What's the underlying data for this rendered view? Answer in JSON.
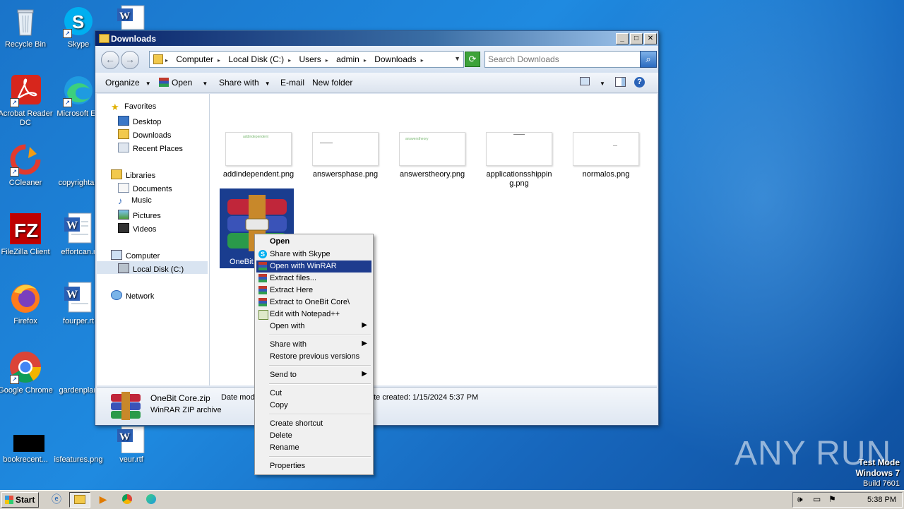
{
  "desktop": {
    "icons": [
      {
        "label": "Recycle Bin"
      },
      {
        "label": "Skype"
      },
      {
        "label": "Acrobat Reader DC"
      },
      {
        "label": "Microsoft Ed"
      },
      {
        "label": "CCleaner"
      },
      {
        "label": "copyrightap"
      },
      {
        "label": "FileZilla Client"
      },
      {
        "label": "effortcan.r"
      },
      {
        "label": "Firefox"
      },
      {
        "label": "fourper.rt"
      },
      {
        "label": "Google Chrome"
      },
      {
        "label": "gardenplan"
      },
      {
        "label": "bookrecent..."
      },
      {
        "label": "isfeatures.png"
      },
      {
        "label": "veur.rtf"
      }
    ]
  },
  "window": {
    "title": "Downloads",
    "breadcrumbs": [
      "Computer",
      "Local Disk (C:)",
      "Users",
      "admin",
      "Downloads"
    ],
    "search_placeholder": "Search Downloads",
    "toolbar": {
      "organize": "Organize",
      "open": "Open",
      "share_with": "Share with",
      "email": "E-mail",
      "new_folder": "New folder"
    },
    "nav": {
      "favorites": "Favorites",
      "desktop": "Desktop",
      "downloads": "Downloads",
      "recent": "Recent Places",
      "libraries": "Libraries",
      "documents": "Documents",
      "music": "Music",
      "pictures": "Pictures",
      "videos": "Videos",
      "computer": "Computer",
      "local_disk": "Local Disk (C:)",
      "network": "Network"
    },
    "files": [
      {
        "name": "addindependent.png",
        "thumb_text": "addindependent"
      },
      {
        "name": "answersphase.png",
        "thumb_text": ""
      },
      {
        "name": "answerstheory.png",
        "thumb_text": "answerstheory"
      },
      {
        "name": "applicationsshipping.png",
        "thumb_text": ""
      },
      {
        "name": "normalos.png",
        "thumb_text": ""
      }
    ],
    "selected_file_label": "OneBit",
    "details": {
      "name": "OneBit Core.zip",
      "type": "WinRAR ZIP archive",
      "date_modified_label": "Date mod",
      "date_created": "ate created:  1/15/2024 5:37 PM"
    }
  },
  "context_menu": {
    "open": "Open",
    "share_skype": "Share with Skype",
    "open_winrar": "Open with WinRAR",
    "extract_files": "Extract files...",
    "extract_here": "Extract Here",
    "extract_to": "Extract to OneBit Core\\",
    "edit_notepad": "Edit with Notepad++",
    "open_with": "Open with",
    "share_with": "Share with",
    "restore": "Restore previous versions",
    "send_to": "Send to",
    "cut": "Cut",
    "copy": "Copy",
    "create_shortcut": "Create shortcut",
    "delete": "Delete",
    "rename": "Rename",
    "properties": "Properties"
  },
  "taskbar": {
    "start": "Start",
    "clock": "5:38 PM"
  },
  "watermark": "ANY RUN",
  "testmode": {
    "line1": "Test Mode",
    "line2": "Windows 7",
    "line3": "Build 7601"
  }
}
